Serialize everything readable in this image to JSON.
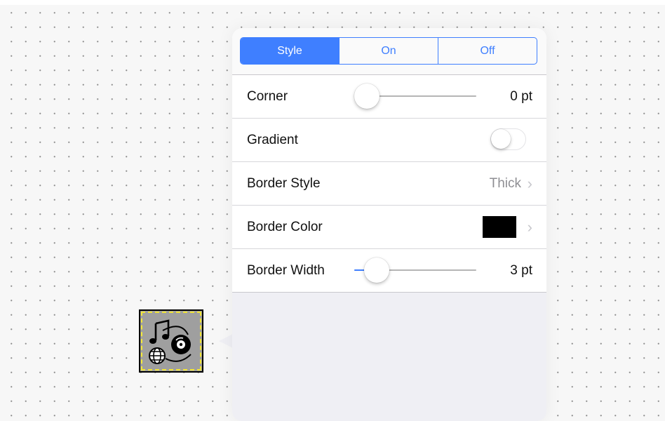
{
  "popover": {
    "segments": [
      {
        "label": "Style",
        "active": true
      },
      {
        "label": "On",
        "active": false
      },
      {
        "label": "Off",
        "active": false
      }
    ],
    "rows": {
      "corner": {
        "label": "Corner",
        "value": "0 pt",
        "slider_fraction": 0.0
      },
      "gradient": {
        "label": "Gradient",
        "toggle_on": false
      },
      "border_style": {
        "label": "Border Style",
        "value": "Thick",
        "chevron": "›"
      },
      "border_color": {
        "label": "Border Color",
        "swatch_color": "#000000",
        "chevron": "›"
      },
      "border_width": {
        "label": "Border Width",
        "value": "3 pt",
        "slider_fraction": 0.1
      }
    }
  },
  "canvas_shape": {
    "icon": "music-globe-disc-icon",
    "fill_color": "#9f9f9f",
    "selection_color": "#f1e537"
  },
  "colors": {
    "accent": "#3f7fff",
    "popover_bg": "#efeff4"
  }
}
